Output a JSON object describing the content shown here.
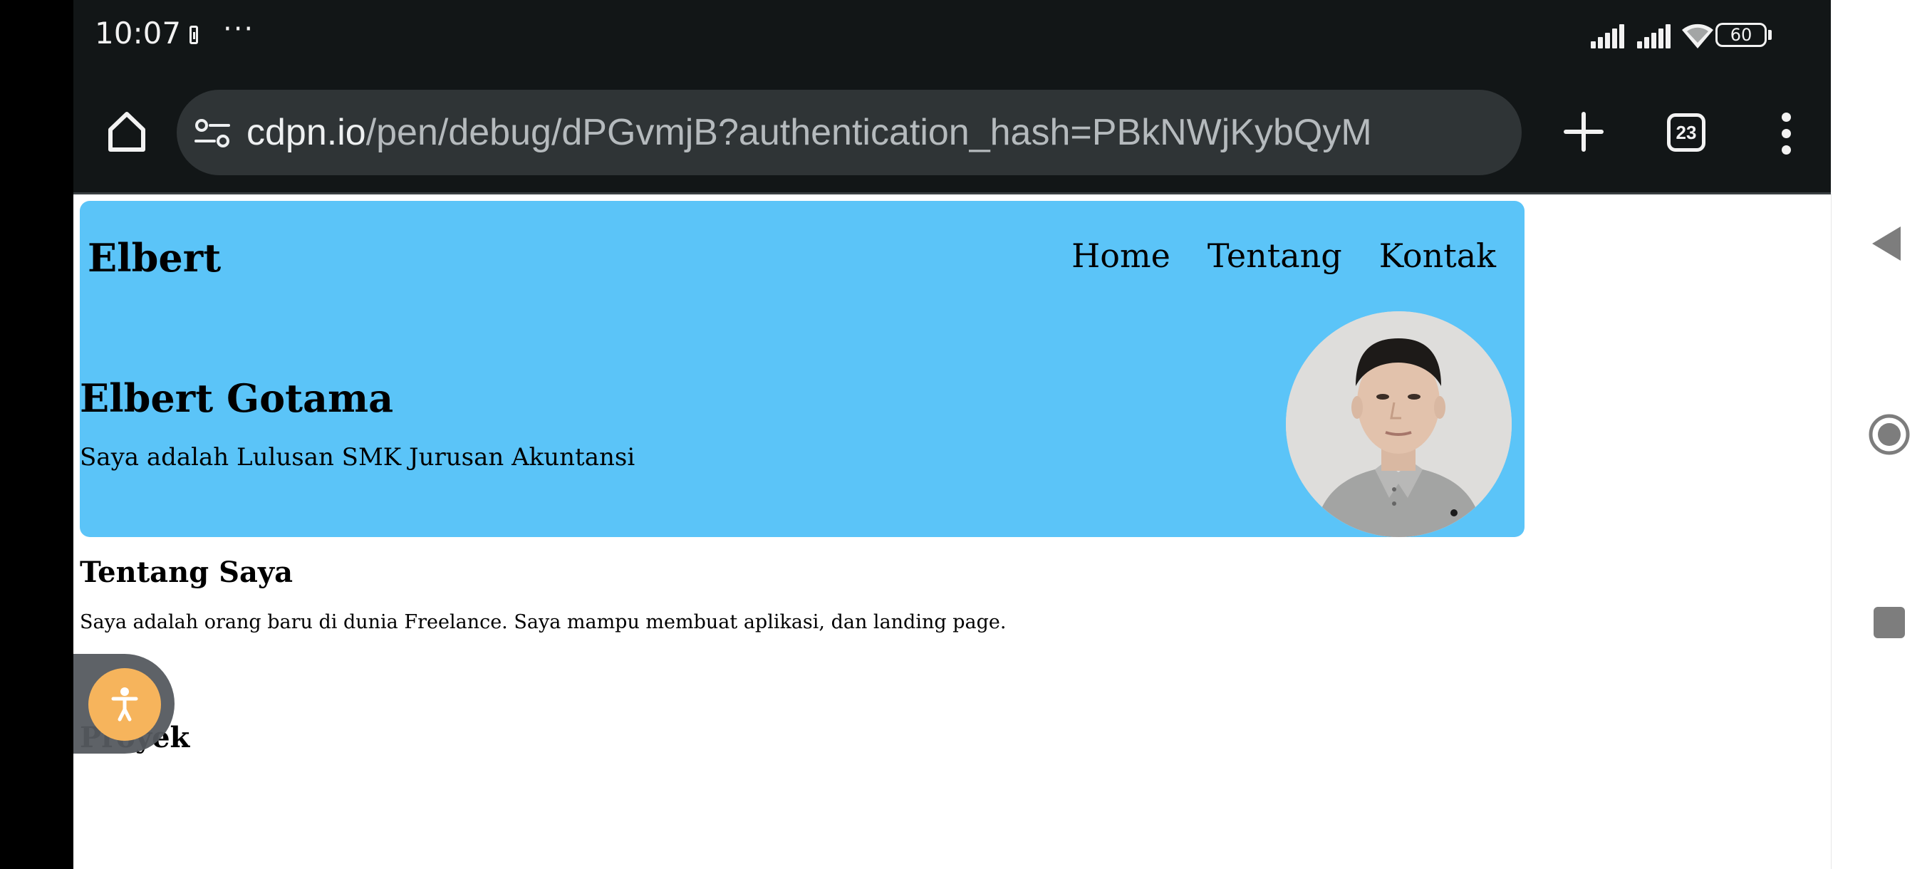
{
  "status_bar": {
    "time": "10:07",
    "more_dots": "···",
    "battery": "60"
  },
  "toolbar": {
    "url_host": "cdpn.io",
    "url_path": "/pen/debug/dPGvmjB?authentication_hash=PBkNWjKybQyM",
    "tab_count": "23"
  },
  "site": {
    "brand": "Elbert",
    "nav": [
      "Home",
      "Tentang",
      "Kontak"
    ],
    "hero_title": "Elbert Gotama",
    "hero_subtitle": "Saya adalah Lulusan SMK Jurusan Akuntansi",
    "about_title": "Tentang Saya",
    "about_text": "Saya adalah orang baru di dunia Freelance. Saya mampu membuat aplikasi, dan landing page.",
    "projects_title": "Proyek"
  },
  "colors": {
    "browser_chrome": "#121617",
    "url_bar": "#2f3436",
    "hero_bg": "#5bc4f8",
    "accessibility_button": "#f6b45c"
  },
  "icons": {
    "home": "home-icon",
    "site_settings": "tune-icon",
    "new_tab": "plus-icon",
    "tabs": "tab-switcher-icon",
    "menu": "more-vert-icon",
    "accessibility": "accessibility-icon",
    "back": "back-triangle-icon",
    "home_nav": "home-circle-icon",
    "recents": "recents-square-icon"
  }
}
